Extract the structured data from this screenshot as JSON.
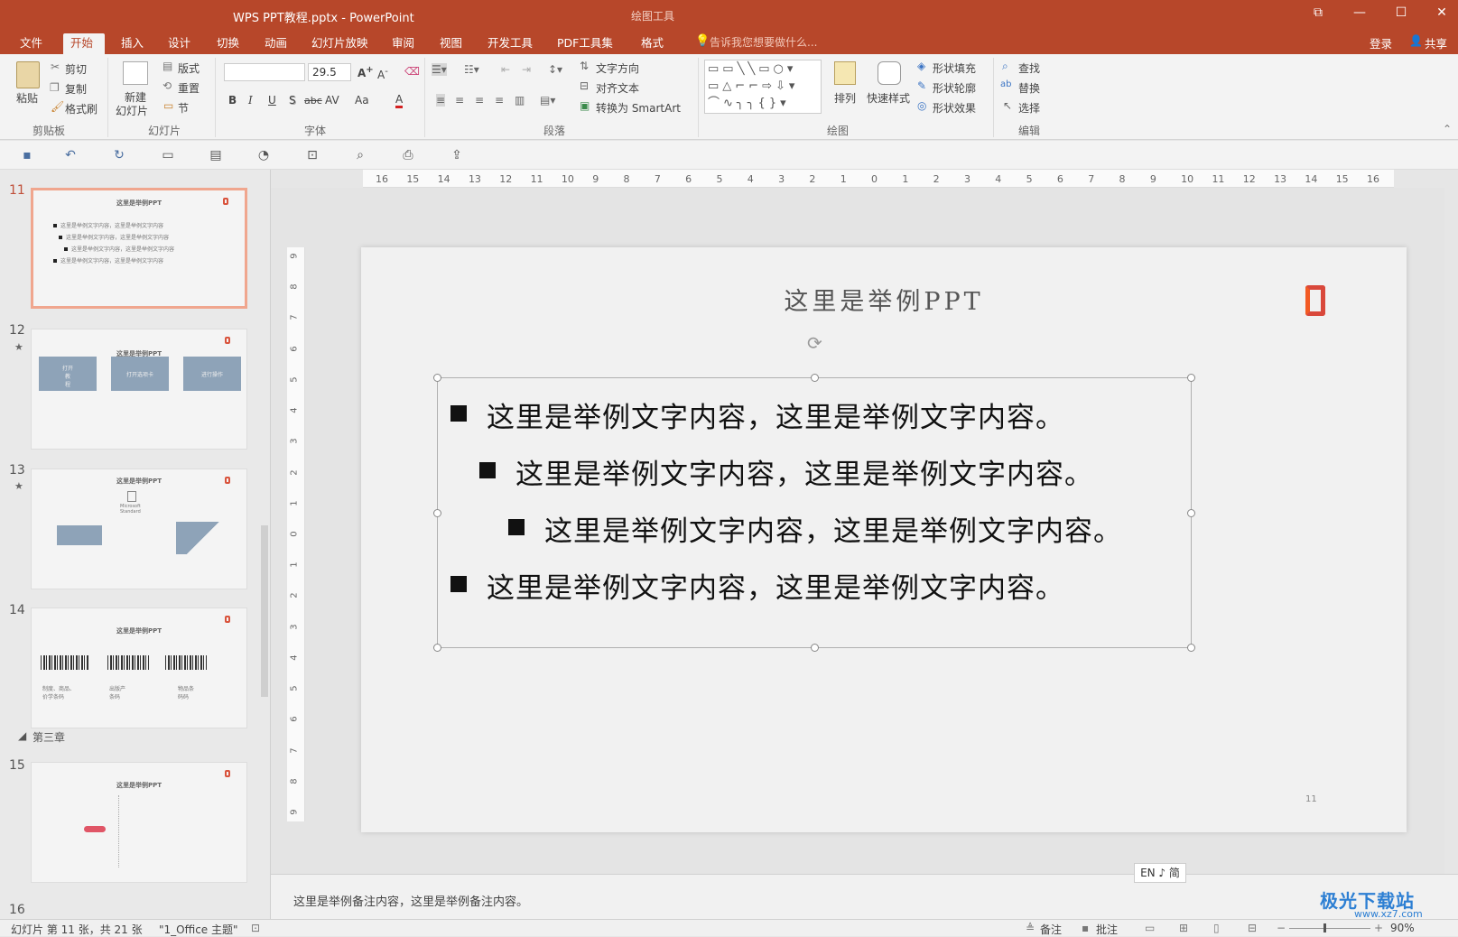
{
  "titlebar": {
    "title": "WPS PPT教程.pptx - PowerPoint",
    "context": "绘图工具",
    "restore": "⧉",
    "minimize": "—",
    "maximize": "☐",
    "close": "✕"
  },
  "tabs": [
    {
      "label": "文件"
    },
    {
      "label": "开始"
    },
    {
      "label": "插入"
    },
    {
      "label": "设计"
    },
    {
      "label": "切换"
    },
    {
      "label": "动画"
    },
    {
      "label": "幻灯片放映"
    },
    {
      "label": "审阅"
    },
    {
      "label": "视图"
    },
    {
      "label": "开发工具"
    },
    {
      "label": "PDF工具集"
    },
    {
      "label": "格式"
    }
  ],
  "tellme": "告诉我您想要做什么...",
  "account": {
    "signin": "登录",
    "share": "共享"
  },
  "ribbon": {
    "clipboard": {
      "paste": "粘贴",
      "cut": "剪切",
      "copy": "复制",
      "format_painter": "格式刷",
      "label": "剪贴板"
    },
    "slides": {
      "new_slide_1": "新建",
      "new_slide_2": "幻灯片",
      "layout": "版式",
      "reset": "重置",
      "section": "节",
      "label": "幻灯片"
    },
    "font": {
      "name": "",
      "size": "29.5",
      "bold": "B",
      "italic": "I",
      "underline": "U",
      "shadow": "S",
      "strike": "abc",
      "spacing": "AV",
      "case": "Aa",
      "color": "A",
      "label": "字体"
    },
    "paragraph": {
      "text_direction": "文字方向",
      "align_text": "对齐文本",
      "convert_smartart": "转换为 SmartArt",
      "label": "段落"
    },
    "drawing": {
      "arrange": "排列",
      "quick_styles": "快速样式",
      "shape_fill": "形状填充",
      "shape_outline": "形状轮廓",
      "shape_effects": "形状效果",
      "label": "绘图"
    },
    "editing": {
      "find": "查找",
      "replace": "替换",
      "select": "选择",
      "label": "编辑"
    }
  },
  "ruler": {
    "h_ticks": [
      "16",
      "15",
      "14",
      "13",
      "12",
      "11",
      "10",
      "9",
      "8",
      "7",
      "6",
      "5",
      "4",
      "3",
      "2",
      "1",
      "0",
      "1",
      "2",
      "3",
      "4",
      "5",
      "6",
      "7",
      "8",
      "9",
      "10",
      "11",
      "12",
      "13",
      "14",
      "15",
      "16"
    ],
    "v_ticks": [
      "9",
      "8",
      "7",
      "6",
      "5",
      "4",
      "3",
      "2",
      "1",
      "0",
      "1",
      "2",
      "3",
      "4",
      "5",
      "6",
      "7",
      "8",
      "9"
    ]
  },
  "thumbnails": [
    {
      "num": "11",
      "star": "",
      "title": "这里是举例PPT",
      "lines": [
        "这里是举例文字内容，这里是举例文字内容",
        "这里是举例文字内容，这里是举例文字内容",
        "这里是举例文字内容，这里是举例文字内容",
        "这里是举例文字内容，这里是举例文字内容"
      ]
    },
    {
      "num": "12",
      "star": "★",
      "title": "这里是举例PPT",
      "boxes": [
        "打开\n教\n程",
        "打开选项卡",
        "进行操作"
      ]
    },
    {
      "num": "13",
      "star": "★",
      "title": "这里是举例PPT",
      "caption": "Microsoft\nStandard"
    },
    {
      "num": "14",
      "star": "",
      "title": "这里是举例PPT",
      "captions": [
        "制度、商品、\n价学条码",
        "出版产\n条码",
        "物品条\n码码"
      ]
    },
    {
      "num": "15",
      "star": "",
      "title": "这里是举例PPT"
    },
    {
      "num": "16",
      "star": ""
    }
  ],
  "section_name": "第三章",
  "slide": {
    "title": "这里是举例PPT",
    "page": "11",
    "bullets": [
      "这里是举例文字内容，这里是举例文字内容。",
      "这里是举例文字内容，这里是举例文字内容。",
      "这里是举例文字内容，这里是举例文字内容。",
      "这里是举例文字内容，这里是举例文字内容。"
    ]
  },
  "notes": "这里是举例备注内容，这里是举例备注内容。",
  "ime": "EN ♪ 简",
  "status": {
    "slide_info": "幻灯片 第 11 张，共 21 张",
    "theme": "\"1_Office 主题\"",
    "notes": "备注",
    "comments": "批注",
    "zoom": "90%"
  },
  "watermark": {
    "text": "极光下载站",
    "url": "www.xz7.com"
  }
}
